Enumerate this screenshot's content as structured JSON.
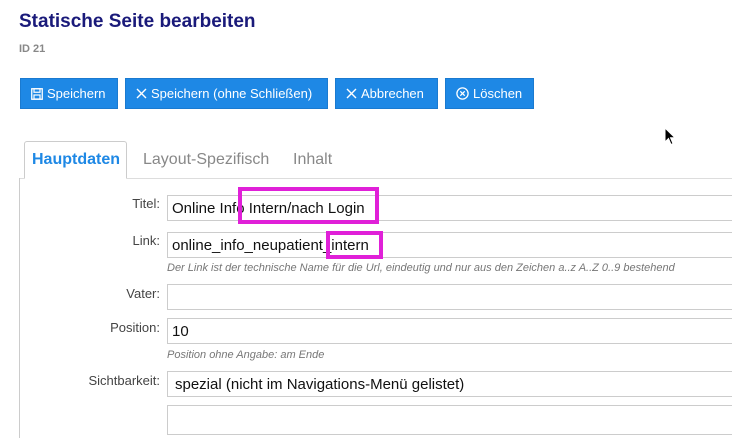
{
  "page": {
    "title": "Statische Seite bearbeiten",
    "id_label": "ID 21"
  },
  "toolbar": {
    "save": "Speichern",
    "save_no_close": "Speichern (ohne Schließen)",
    "cancel": "Abbrechen",
    "delete": "Löschen"
  },
  "tabs": {
    "main": "Hauptdaten",
    "layout": "Layout-Spezifisch",
    "content": "Inhalt"
  },
  "form": {
    "title_label": "Titel:",
    "title_value": "Online Info Intern/nach Login",
    "link_label": "Link:",
    "link_value": "online_info_neupatient_intern",
    "link_hint": "Der Link ist der technische Name für die Url, eindeutig und nur aus den Zeichen a..z A..Z 0..9 bestehend",
    "parent_label": "Vater:",
    "parent_value": "",
    "position_label": "Position:",
    "position_value": "10",
    "position_hint": "Position ohne Angabe: am Ende",
    "visibility_label": "Sichtbarkeit:",
    "visibility_value": "spezial (nicht im Navigations-Menü gelistet)"
  },
  "colors": {
    "button": "#1e88e5",
    "title": "#1a1a7a",
    "highlight": "#e020d8"
  },
  "icons": [
    "save-icon",
    "close-icon",
    "close-icon",
    "delete-circle-icon",
    "mouse-cursor-icon"
  ]
}
